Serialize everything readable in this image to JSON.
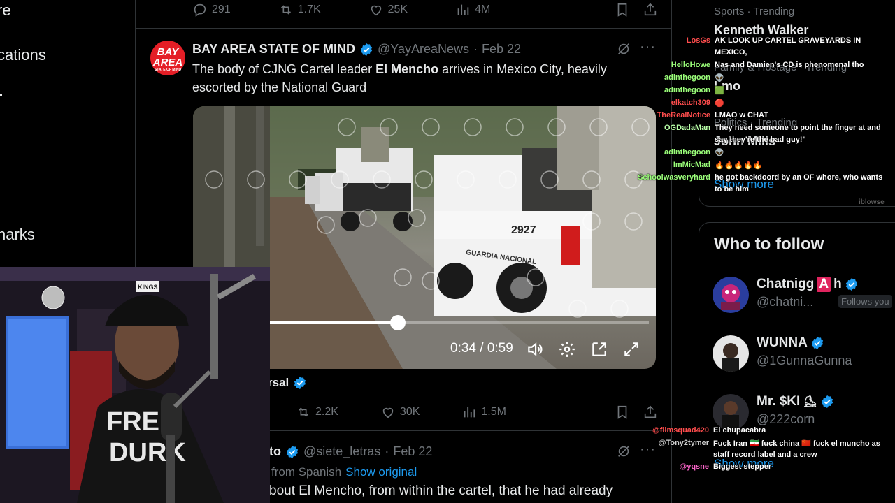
{
  "left_nav": {
    "items": [
      "re",
      "cations",
      "narks"
    ]
  },
  "feed": {
    "top_actions": {
      "replies": "291",
      "reposts": "1.7K",
      "likes": "25K",
      "views": "4M"
    },
    "tweet": {
      "avatar_text": "BAY AREA",
      "avatar_subtext": "STATE OF MIND",
      "name": "BAY AREA STATE OF MIND",
      "handle": "@YayAreaNews",
      "dot": "·",
      "date": "Feb 22",
      "body_pre": "The body of CJNG Cartel leader ",
      "body_bold": "El Mencho",
      "body_post": " arrives in Mexico City, heavily escorted by the National Guard",
      "more": "···"
    },
    "video": {
      "time": "0:34 / 0:59",
      "progress": 0.45,
      "truck_number": "2927",
      "truck_text": "GUARDIA NACIONAL"
    },
    "attribution": "rsal",
    "second_actions": {
      "reposts": "2.2K",
      "likes": "30K",
      "views": "1.5M"
    },
    "tweet3": {
      "name": "to",
      "handle": "@siete_letras",
      "dot": "·",
      "date": "Feb 22",
      "translated": "from Spanish",
      "show_original": "Show original",
      "body": "bout El Mencho, from within the cartel, that he had already",
      "more": "···"
    }
  },
  "sidebar": {
    "trends": [
      {
        "category": "Sports · Trending",
        "name": "Kenneth Walker"
      },
      {
        "category": "Family & Hostage · Trending",
        "name": "Lmo"
      },
      {
        "category": "Politics · Trending",
        "name": "John Mills"
      }
    ],
    "trends_show_more": "Show more",
    "who_to_follow_title": "Who to follow",
    "who": [
      {
        "name_pre": "Chatnigg",
        "name_badge": "A",
        "name_post": "h",
        "handle": "@chatni...",
        "follows_you": "Follows you"
      },
      {
        "name": "WUNNA",
        "handle": "@1GunnaGunna"
      },
      {
        "name": "Mr. $KI",
        "handle": "@222corn"
      }
    ],
    "who_show_more": "Show more"
  },
  "chat": [
    {
      "user": "LosGs",
      "color": "#ff4d4d",
      "msg": "AK LOOK UP CARTEL GRAVEYARDS IN",
      "msg2": "MEXICO,"
    },
    {
      "user": "HelloHowe",
      "color": "#9bff7a",
      "msg": "Nas and Damien's CD is phenomenal tho"
    },
    {
      "user": "adinthegoon",
      "color": "#9bff7a",
      "msg": "👽"
    },
    {
      "user": "adinthegoon",
      "color": "#9bff7a",
      "msg": "🟩"
    },
    {
      "user": "elkatch309",
      "color": "#ff4d4d",
      "msg": "🔴"
    },
    {
      "user": "TheRealNotice",
      "color": "#ff4d4d",
      "msg": "LMAO w CHAT"
    },
    {
      "user": "OGDadaMan",
      "color": "#b9ffa8",
      "msg": "They need someone to point the finger at and",
      "msg2": "say they're the bad guy!\""
    },
    {
      "user": "adinthegoon",
      "color": "#9bff7a",
      "msg": "👽"
    },
    {
      "user": "ImMicMad",
      "color": "#9bff7a",
      "msg": "🔥🔥🔥🔥🔥"
    },
    {
      "user": "Schoolwasveryhard",
      "color": "#9bff7a",
      "msg": "he got backdoord by an OF whore, who wants",
      "msg2": "to be him"
    },
    {
      "user": "@filmsquad420",
      "color": "#ff4d4d",
      "msg": "El chupacabra"
    },
    {
      "user": "@Tony2tymer",
      "color": "#d0d0d0",
      "msg": "Fuck Iran 🇮🇷 fuck china 🇨🇳 fuck el muncho as",
      "msg2": "staff record label and a crew"
    },
    {
      "user": "@yqsne",
      "color": "#ff66cc",
      "msg": "Biggest stepper"
    }
  ],
  "watermark": "iblowse",
  "webcam": {
    "hat_text": "KINGS",
    "shirt_text_1": "FREE",
    "shirt_text_2": "DURK"
  },
  "colors": {
    "accent": "#1d9bf0",
    "muted": "#71767b",
    "divider": "#2f3336",
    "bg": "#000000",
    "brand_red": "#e41e26"
  }
}
